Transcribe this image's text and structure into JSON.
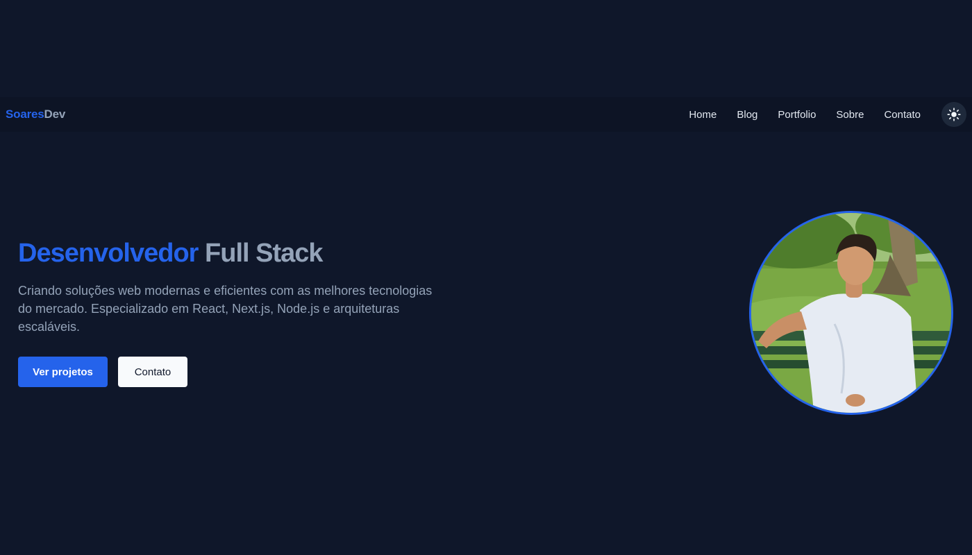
{
  "brand": {
    "part1": "Soares",
    "part2": "Dev"
  },
  "nav": {
    "links": [
      "Home",
      "Blog",
      "Portfolio",
      "Sobre",
      "Contato"
    ],
    "theme_toggle_icon": "sun-icon"
  },
  "hero": {
    "title_highlight": "Desenvolvedor",
    "title_rest": "Full Stack",
    "description": "Criando soluções web modernas e eficientes com as melhores tecnologias do mercado. Especializado em React, Next.js, Node.js e arquiteturas escaláveis.",
    "primary_button": "Ver projetos",
    "secondary_button": "Contato"
  },
  "colors": {
    "background": "#0f172a",
    "accent": "#2563eb",
    "muted_text": "#94a3b8"
  }
}
